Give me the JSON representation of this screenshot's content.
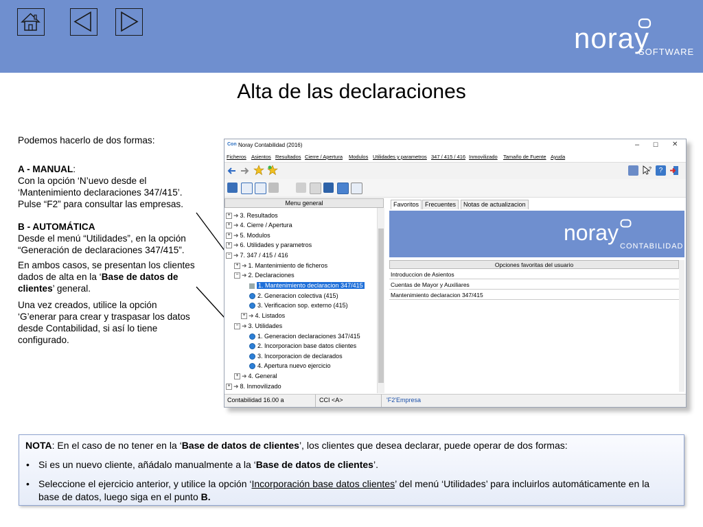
{
  "header": {
    "home_icon": "home-icon",
    "back_icon": "triangle-left-icon",
    "forward_icon": "triangle-right-icon",
    "brand_word": "noray",
    "brand_sub": "SOFTWARE",
    "bg_color": "#6f8fcf"
  },
  "slide": {
    "title": "Alta de las declaraciones"
  },
  "left": {
    "intro": "Podemos hacerlo de dos formas:",
    "manual_title": "A - MANUAL",
    "manual_colon": ":",
    "manual_line1": "Con la opción ‘N’uevo desde el",
    "manual_line2": "‘Mantenimiento  declaraciones 347/415’.",
    "manual_line3": "Pulse “F2” para consultar las empresas.",
    "auto_title": "B - AUTOMÁTICA",
    "auto_line1": "Desde el menú “Utilidades”, en la opción",
    "auto_line2": "“Generación de declaraciones 347/415”.",
    "both_pre": "En ambos casos, se presentan los clientes dados de alta en la ‘",
    "both_bold": "Base de datos de clientes",
    "both_post": "’ general.",
    "once_line1": "Una vez creados, utilice la opción",
    "once_line2": "‘G’enerar para crear y traspasar los datos",
    "once_line3": "desde Contabilidad, si así lo tiene",
    "once_line4": "configurado."
  },
  "app": {
    "window_title": "Noray Contabilidad (2016)",
    "app_icon_text": "Con",
    "window_controls": [
      "–",
      "☐",
      "✕"
    ],
    "menu": [
      "Ficheros",
      "Asientos",
      "Resultados",
      "Cierre / Apertura",
      "Modulos",
      "Utilidades y parametros",
      "347 / 415 / 416",
      "Inmovilizado",
      "Tamaño de Fuente",
      "Ayuda"
    ],
    "left_panel_title": "Menu general",
    "tree": [
      {
        "label": "3. Resultados"
      },
      {
        "label": "4. Cierre / Apertura"
      },
      {
        "label": "5. Modulos"
      },
      {
        "label": "6. Utilidades y parametros"
      },
      {
        "label": "7. 347 / 415 / 416"
      },
      {
        "label": "1. Mantenimiento de ficheros"
      },
      {
        "label": "2. Declaraciones"
      },
      {
        "label": "1. Mantenimiento declaracion 347/415"
      },
      {
        "label": "2. Generacion colectiva (415)"
      },
      {
        "label": "3. Verificacion sop. externo (415)"
      },
      {
        "label": "4. Listados"
      },
      {
        "label": "3. Utilidades"
      },
      {
        "label": "1. Generacion declaraciones 347/415"
      },
      {
        "label": "2. Incorporacion base datos clientes"
      },
      {
        "label": "3. Incorporacion de declarados"
      },
      {
        "label": "4. Apertura nuevo ejercicio"
      },
      {
        "label": "4. General"
      },
      {
        "label": "8. Inmovilizado"
      }
    ],
    "tabs": [
      "Favoritos",
      "Frecuentes",
      "Notas de actualizacion"
    ],
    "banner_word": "noray",
    "banner_sub": "CONTABILIDAD",
    "favorites_title": "Opciones favoritas del usuario",
    "favorites": [
      "Introduccion de Asientos",
      "Cuentas de Mayor y Auxiliares",
      "Mantenimiento declaracion 347/415"
    ],
    "status": [
      "Contabilidad 16.00 a",
      "CCI <A>",
      "'F2'Empresa"
    ]
  },
  "note": {
    "nota_label": "NOTA",
    "nota_pre": ": En el caso de no tener en la ‘",
    "nota_bold": "Base de datos de clientes",
    "nota_post": "’, los clientes que desea declarar, puede operar de dos formas:",
    "b1_pre": "Si es un nuevo cliente, añádalo manualmente a la ‘",
    "b1_bold": "Base de datos de clientes",
    "b1_post": "’.",
    "b2_pre": "Seleccione el ejercicio anterior, y utilice la opción ‘",
    "b2_link": "Incorporación base datos clientes",
    "b2_mid": "’ del menú ‘Utilidades’ para incluirlos automáticamente en la base de datos, luego siga en el punto ",
    "b2_bold": "B.",
    "bullet": "•"
  }
}
